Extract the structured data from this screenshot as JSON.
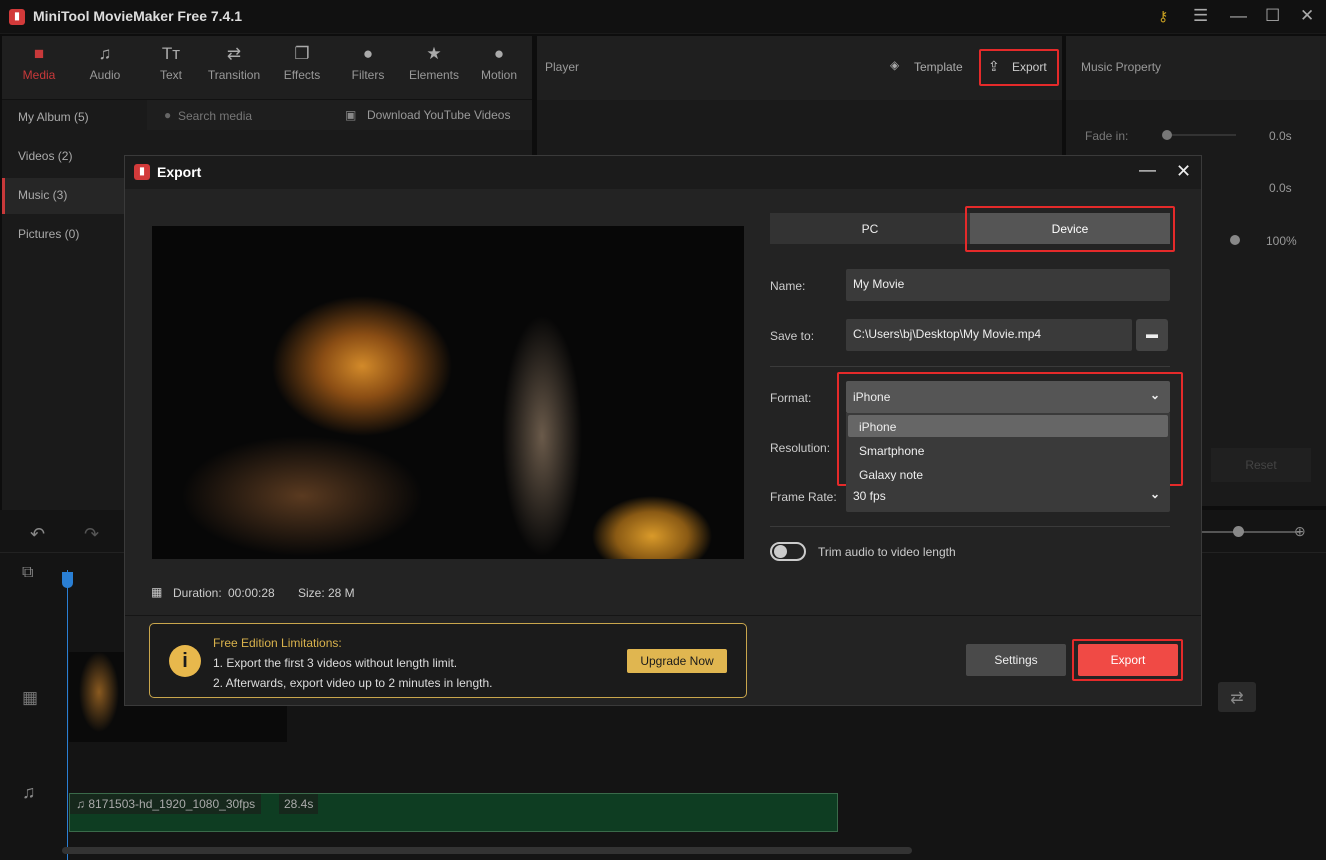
{
  "app": {
    "title": "MiniTool MovieMaker Free 7.4.1",
    "logo_text": "MiniTool"
  },
  "toolbar": [
    {
      "label": "Media",
      "icon": "folder-icon",
      "active": true
    },
    {
      "label": "Audio",
      "icon": "music-note-icon"
    },
    {
      "label": "Text",
      "icon": "text-icon"
    },
    {
      "label": "Transition",
      "icon": "swap-arrows-icon"
    },
    {
      "label": "Effects",
      "icon": "layers-icon"
    },
    {
      "label": "Filters",
      "icon": "circles-icon"
    },
    {
      "label": "Elements",
      "icon": "star-list-icon"
    },
    {
      "label": "Motion",
      "icon": "ball-icon"
    }
  ],
  "sidebar": [
    {
      "label": "My Album (5)"
    },
    {
      "label": "Videos (2)"
    },
    {
      "label": "Music (3)",
      "selected": true
    },
    {
      "label": "Pictures (0)"
    }
  ],
  "search": {
    "placeholder": "Search media",
    "download": "Download YouTube Videos"
  },
  "player": {
    "title": "Player",
    "template": "Template",
    "export": "Export"
  },
  "music_property": {
    "title": "Music Property",
    "fade_in_label": "Fade in:",
    "fade_in": "0.0s",
    "fade_out": "0.0s",
    "volume": "100%",
    "reset": "Reset"
  },
  "dialog": {
    "title": "Export",
    "tabs": [
      {
        "label": "PC"
      },
      {
        "label": "Device",
        "selected": true
      }
    ],
    "name_label": "Name:",
    "name_value": "My Movie",
    "save_label": "Save to:",
    "save_value": "C:\\Users\\bj\\Desktop\\My Movie.mp4",
    "format_label": "Format:",
    "format_value": "iPhone",
    "format_options": [
      "iPhone",
      "Smartphone",
      "Galaxy note"
    ],
    "resolution_label": "Resolution:",
    "framerate_label": "Frame Rate:",
    "framerate_value": "30 fps",
    "trim_label": "Trim audio to video length",
    "trim_on": false,
    "duration_label": "Duration:",
    "duration": "00:00:28",
    "size_label": "Size:",
    "size": "28 M",
    "limits_title": "Free Edition Limitations:",
    "limits_1": "1. Export the first 3 videos without length limit.",
    "limits_2": "2. Afterwards, export video up to 2 minutes in length.",
    "upgrade": "Upgrade Now",
    "settings": "Settings",
    "export": "Export"
  },
  "timeline": {
    "audio_clip": "8171503-hd_1920_1080_30fps",
    "audio_duration": "28.4s"
  },
  "colors": {
    "accent": "#c8393a",
    "export_button": "#f04a45",
    "highlight": "#e52a2a",
    "gold": "#c9a64c",
    "audio_track": "#0e3d22"
  }
}
